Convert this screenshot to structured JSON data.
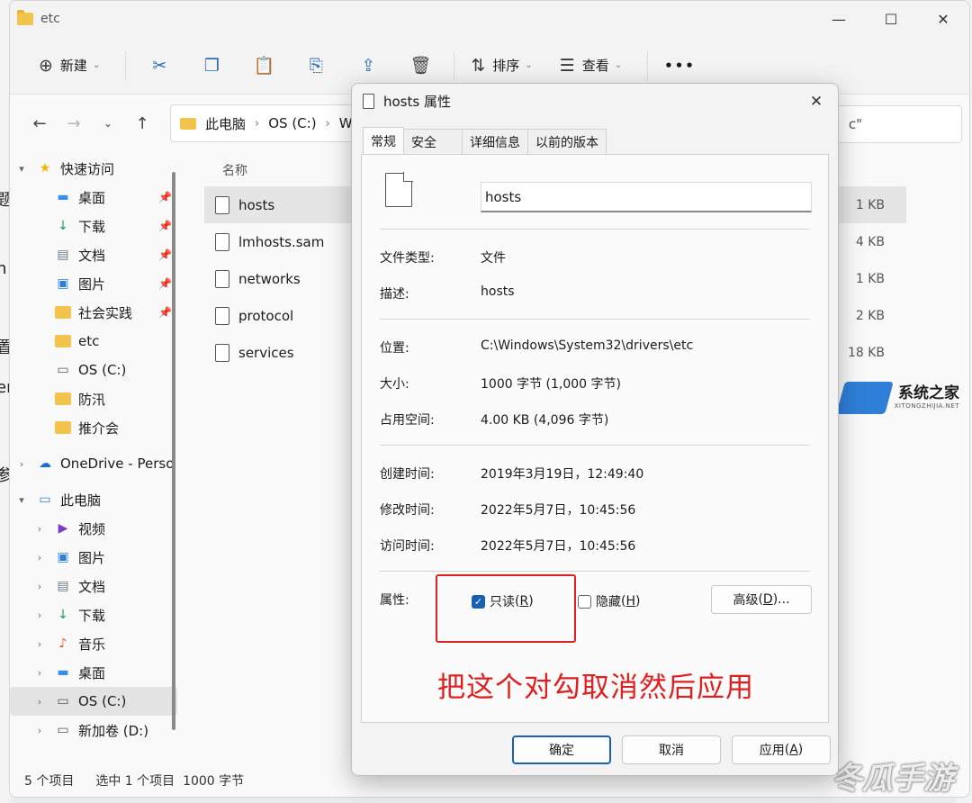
{
  "explorer": {
    "window_title": "etc",
    "toolbar": {
      "new_label": "新建",
      "sort_label": "排序",
      "view_label": "查看",
      "more_label": "•••"
    },
    "breadcrumb": [
      "此电脑",
      "OS (C:)",
      "W"
    ],
    "search_fragment": "c\"",
    "column_name": "名称",
    "sidebar": [
      {
        "label": "快速访问",
        "icon": "star-icon",
        "expand": "▾",
        "indent": 0
      },
      {
        "label": "桌面",
        "icon": "desktop-icon",
        "pinned": true,
        "indent": 1
      },
      {
        "label": "下载",
        "icon": "download-icon",
        "pinned": true,
        "indent": 1
      },
      {
        "label": "文档",
        "icon": "document-icon",
        "pinned": true,
        "indent": 1
      },
      {
        "label": "图片",
        "icon": "picture-icon",
        "pinned": true,
        "indent": 1
      },
      {
        "label": "社会实践",
        "icon": "folder-icon",
        "pinned": true,
        "indent": 1
      },
      {
        "label": "etc",
        "icon": "folder-icon",
        "indent": 1
      },
      {
        "label": "OS (C:)",
        "icon": "drive-icon",
        "indent": 1
      },
      {
        "label": "防汛",
        "icon": "folder-icon",
        "indent": 1
      },
      {
        "label": "推介会",
        "icon": "folder-icon",
        "indent": 1
      },
      {
        "label": "OneDrive - Perso",
        "icon": "cloud-icon",
        "expand": "›",
        "indent": 0
      },
      {
        "label": "此电脑",
        "icon": "computer-icon",
        "expand": "▾",
        "indent": 0
      },
      {
        "label": "视频",
        "icon": "video-icon",
        "expand": "›",
        "indent": 1
      },
      {
        "label": "图片",
        "icon": "picture-icon",
        "expand": "›",
        "indent": 1
      },
      {
        "label": "文档",
        "icon": "document-icon",
        "expand": "›",
        "indent": 1
      },
      {
        "label": "下载",
        "icon": "download-icon",
        "expand": "›",
        "indent": 1
      },
      {
        "label": "音乐",
        "icon": "music-icon",
        "expand": "›",
        "indent": 1
      },
      {
        "label": "桌面",
        "icon": "desktop-icon",
        "expand": "›",
        "indent": 1
      },
      {
        "label": "OS (C:)",
        "icon": "drive-icon",
        "expand": "›",
        "indent": 1,
        "selected": true
      },
      {
        "label": "新加卷 (D:)",
        "icon": "drive-icon",
        "expand": "›",
        "indent": 1
      }
    ],
    "files": [
      {
        "name": "hosts",
        "size": "1 KB",
        "selected": true
      },
      {
        "name": "lmhosts.sam",
        "size": "4 KB"
      },
      {
        "name": "networks",
        "size": "1 KB"
      },
      {
        "name": "protocol",
        "size": "2 KB"
      },
      {
        "name": "services",
        "size": "18 KB"
      }
    ],
    "status": {
      "count": "5 个项目",
      "selected": "选中 1 个项目  1000 字节"
    }
  },
  "dialog": {
    "title": "hosts 属性",
    "tabs": [
      "常规",
      "安全",
      "详细信息",
      "以前的版本"
    ],
    "active_tab": "常规",
    "file_name": "hosts",
    "props": {
      "type_label": "文件类型:",
      "type_value": "文件",
      "desc_label": "描述:",
      "desc_value": "hosts",
      "location_label": "位置:",
      "location_value": "C:\\Windows\\System32\\drivers\\etc",
      "size_label": "大小:",
      "size_value": "1000 字节 (1,000 字节)",
      "disk_label": "占用空间:",
      "disk_value": "4.00 KB (4,096 字节)",
      "created_label": "创建时间:",
      "created_value": "2019年3月19日，12:49:40",
      "modified_label": "修改时间:",
      "modified_value": "2022年5月7日，10:45:56",
      "accessed_label": "访问时间:",
      "accessed_value": "2022年5月7日，10:45:56",
      "attr_label": "属性:"
    },
    "readonly": {
      "label": "只读",
      "key": "R",
      "checked": true
    },
    "hidden": {
      "label": "隐藏",
      "key": "H",
      "checked": false
    },
    "advanced": {
      "label": "高级",
      "key": "D",
      "suffix": "..."
    },
    "annotation": "把这个对勾取消然后应用",
    "buttons": {
      "ok": "确定",
      "cancel": "取消",
      "apply": "应用",
      "apply_key": "A"
    }
  },
  "watermarks": {
    "logo_text": "系统之家",
    "logo_url": "XITONGZHIJIA.NET",
    "bottom_text": "冬瓜手游"
  },
  "colors": {
    "accent": "#1a5fb4",
    "annotation": "#e02020",
    "folder": "#f3c44b"
  }
}
